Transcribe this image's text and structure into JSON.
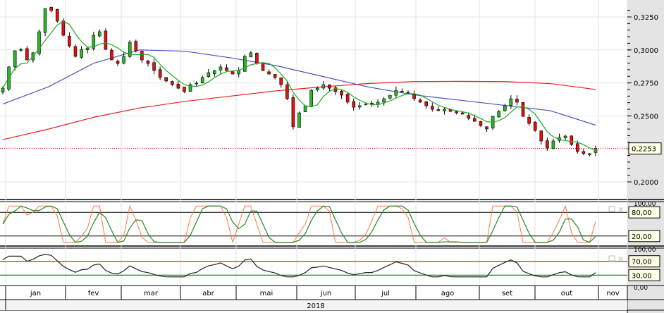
{
  "chart_data": {
    "type": "candlestick",
    "symbol_last_price": "0,2253",
    "price_axis": {
      "ticks": [
        "0,2000",
        "0,2500",
        "0,2750",
        "0,3000",
        "0,3250"
      ],
      "tick_values": [
        0.2,
        0.25,
        0.275,
        0.3,
        0.325
      ],
      "ylim": [
        0.1965,
        0.338
      ]
    },
    "closes": [
      0.271,
      0.2871,
      0.2994,
      0.3004,
      0.2924,
      0.2978,
      0.3138,
      0.3314,
      0.3298,
      0.3218,
      0.3111,
      0.3031,
      0.2951,
      0.3004,
      0.3015,
      0.3111,
      0.3138,
      0.3004,
      0.2924,
      0.2897,
      0.2951,
      0.3058,
      0.2994,
      0.2924,
      0.2897,
      0.2844,
      0.2791,
      0.2764,
      0.2737,
      0.271,
      0.2684,
      0.2737,
      0.2748,
      0.2791,
      0.2828,
      0.2844,
      0.2871,
      0.2844,
      0.2817,
      0.2844,
      0.2951,
      0.2978,
      0.2897,
      0.2844,
      0.2817,
      0.2791,
      0.2737,
      0.263,
      0.2417,
      0.2523,
      0.2577,
      0.2694,
      0.271,
      0.2737,
      0.271,
      0.2684,
      0.2657,
      0.2604,
      0.2566,
      0.2577,
      0.2588,
      0.2588,
      0.2604,
      0.263,
      0.2657,
      0.2694,
      0.2684,
      0.2673,
      0.263,
      0.2604,
      0.2577,
      0.255,
      0.254,
      0.255,
      0.2534,
      0.2523,
      0.2513,
      0.2481,
      0.2459,
      0.2427,
      0.2401,
      0.2497,
      0.2534,
      0.2577,
      0.263,
      0.2604,
      0.2497,
      0.2443,
      0.239,
      0.231,
      0.2256,
      0.231,
      0.2337,
      0.2347,
      0.2283,
      0.223,
      0.2214,
      0.2214,
      0.2253
    ],
    "ma_slow_red": [
      0.232,
      0.24,
      0.249,
      0.256,
      0.261,
      0.265,
      0.269,
      0.272,
      0.2745,
      0.276,
      0.2762,
      0.276,
      0.2745,
      0.27
    ],
    "ma_mid_blue": [
      0.259,
      0.272,
      0.29,
      0.3,
      0.299,
      0.294,
      0.288,
      0.28,
      0.272,
      0.266,
      0.262,
      0.258,
      0.254,
      0.243
    ],
    "stochastic": {
      "levels": [
        "80,00",
        "20,00"
      ],
      "level_values": [
        80,
        20
      ],
      "axis": [
        "100,00",
        "0,00"
      ],
      "range": [
        0,
        100
      ]
    },
    "rsi": {
      "levels": [
        "70,00",
        "30,00"
      ],
      "level_values": [
        70,
        30
      ],
      "axis": [
        "100,00",
        "0,00"
      ],
      "range": [
        0,
        100
      ]
    },
    "months": [
      "jan",
      "fev",
      "mar",
      "abr",
      "mai",
      "jun",
      "jul",
      "ago",
      "set",
      "out",
      "nov"
    ],
    "year": "2018",
    "colors": {
      "up": "#2bb52b",
      "down": "#e01010",
      "ma_fast": "#22aa22",
      "ma_mid": "#4455bb",
      "ma_slow": "#e82020"
    }
  }
}
